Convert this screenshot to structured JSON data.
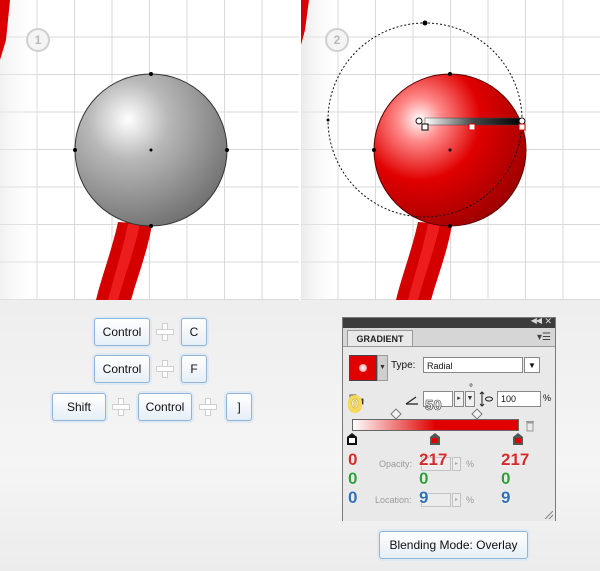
{
  "steps": {
    "step1": "1",
    "step2": "2"
  },
  "shortcuts": {
    "row1": [
      "Control",
      "C"
    ],
    "row2": [
      "Control",
      "F"
    ],
    "row3": [
      "Shift",
      "Control",
      "]"
    ]
  },
  "gradient_panel": {
    "title": "GRADIENT",
    "type_label": "Type:",
    "type_value": "Radial",
    "angle_unit": "°",
    "aspect_value": "100",
    "percent_sign": "%",
    "opacity_label": "Opacity:",
    "location_label": "Location:",
    "annotations": {
      "reverse": "0",
      "angle": "50",
      "left_stop": [
        "0",
        "0",
        "0"
      ],
      "mid_stop": [
        "217",
        "0",
        "9"
      ],
      "right_stop": [
        "217",
        "0",
        "9"
      ]
    },
    "colors": {
      "red": "#e00000",
      "white": "#ffffff"
    }
  },
  "blending_mode_caption": "Blending Mode: Overlay",
  "icons": [
    "plus-icon",
    "reverse-gradient-icon",
    "angle-icon",
    "aspect-ratio-icon",
    "trash-icon",
    "gradient-stop-icon",
    "midpoint-diamond-icon",
    "panel-menu-icon"
  ]
}
